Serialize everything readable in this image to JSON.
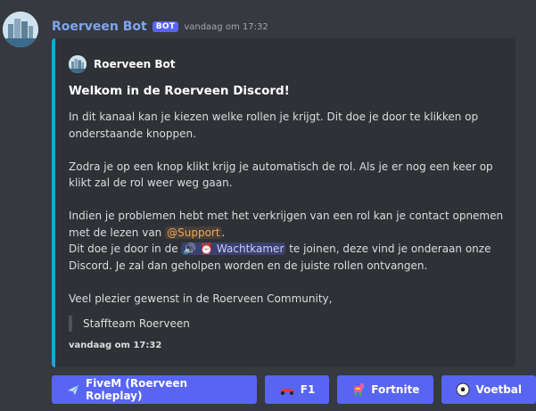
{
  "message": {
    "author": "Roerveen Bot",
    "bot_tag": "BOT",
    "timestamp": "vandaag om 17:32"
  },
  "embed": {
    "author_name": "Roerveen Bot",
    "title": "Welkom in de Roerveen Discord!",
    "paragraph1": "In dit kanaal kan je kiezen welke rollen je krijgt. Dit doe je door te klikken op onderstaande knoppen.",
    "paragraph2": "Zodra je op een knop klikt krijg je automatisch de rol. Als je er nog een keer op klikt zal de rol weer weg gaan.",
    "paragraph3_part1": "Indien je problemen hebt met het verkrijgen van een rol kan je contact opnemen met de lezen van ",
    "role_mention": "@Support",
    "paragraph3_part2": ".",
    "paragraph3_part3": "Dit doe je door in de ",
    "channel_mention": "🔊 ⏰ Wachtkamer",
    "paragraph3_part4": " te joinen, deze vind je onderaan onze Discord. Je zal dan geholpen worden en de juiste rollen ontvangen.",
    "paragraph4": "Veel plezier gewenst in de Roerveen Community,",
    "blockquote": "Staffteam Roerveen",
    "footer": "vandaag om 17:32",
    "accent_color": "#20a2db"
  },
  "buttons": [
    {
      "label": "FiveM (Roerveen Roleplay)",
      "icon": "airplane-icon"
    },
    {
      "label": "F1",
      "icon": "race-car-icon"
    },
    {
      "label": "Fortnite",
      "icon": "llama-icon"
    },
    {
      "label": "Voetbal",
      "icon": "soccer-ball-icon"
    }
  ],
  "colors": {
    "background": "#36393f",
    "embed_background": "#2f3136",
    "button": "#5865f2",
    "author": "#7fa5f0"
  }
}
